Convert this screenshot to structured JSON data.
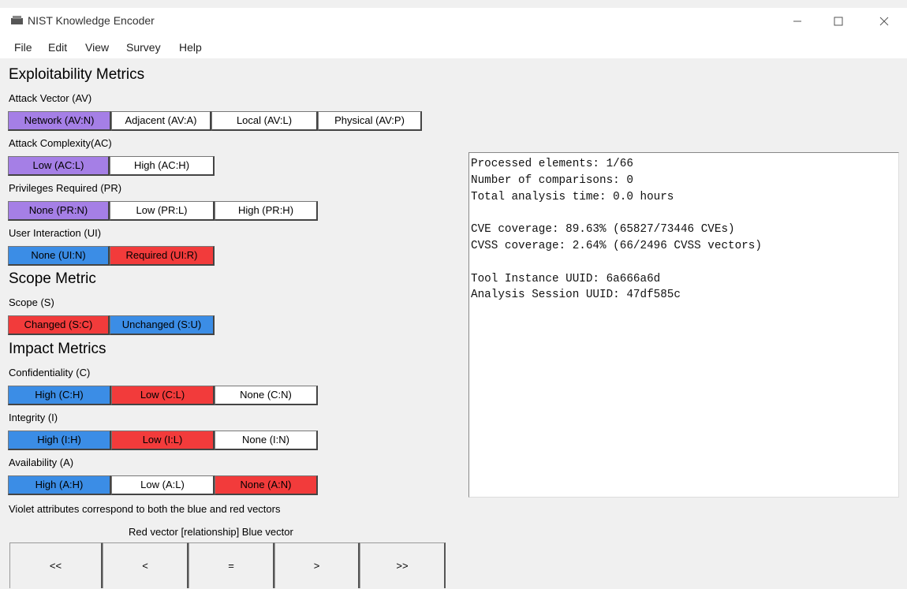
{
  "window": {
    "title": "NIST Knowledge Encoder",
    "controls": {
      "minimize": "—",
      "maximize": "☐",
      "close": "✕"
    }
  },
  "menu": [
    "File",
    "Edit",
    "View",
    "Survey",
    "Help"
  ],
  "sections": {
    "exploitability": "Exploitability Metrics",
    "scope": "Scope Metric",
    "impact": "Impact Metrics"
  },
  "metrics": {
    "av": {
      "label": "Attack Vector (AV)",
      "options": [
        "Network (AV:N)",
        "Adjacent (AV:A)",
        "Local (AV:L)",
        "Physical (AV:P)"
      ]
    },
    "ac": {
      "label": "Attack Complexity(AC)",
      "options": [
        "Low (AC:L)",
        "High (AC:H)"
      ]
    },
    "pr": {
      "label": "Privileges Required (PR)",
      "options": [
        "None (PR:N)",
        "Low (PR:L)",
        "High (PR:H)"
      ]
    },
    "ui": {
      "label": "User Interaction (UI)",
      "options": [
        "None (UI:N)",
        "Required (UI:R)"
      ]
    },
    "s": {
      "label": "Scope (S)",
      "options": [
        "Changed (S:C)",
        "Unchanged (S:U)"
      ]
    },
    "c": {
      "label": "Confidentiality (C)",
      "options": [
        "High (C:H)",
        "Low (C:L)",
        "None (C:N)"
      ]
    },
    "i": {
      "label": "Integrity (I)",
      "options": [
        "High (I:H)",
        "Low (I:L)",
        "None (I:N)"
      ]
    },
    "a": {
      "label": "Availability (A)",
      "options": [
        "High (A:H)",
        "Low (A:L)",
        "None (A:N)"
      ]
    }
  },
  "colors": {
    "violet": "#a57fe6",
    "blue": "#3b8de6",
    "red": "#f23b3b"
  },
  "legend_note": "Violet attributes correspond to both the blue and red vectors",
  "relationship_label": "Red vector [relationship] Blue vector",
  "nav_buttons": [
    "<<",
    "<",
    "=",
    ">",
    ">>"
  ],
  "output": {
    "processed": "Processed elements: 1/66",
    "comparisons": "Number of comparisons: 0",
    "time": "Total analysis time: 0.0 hours",
    "cve": "CVE coverage: 89.63% (65827/73446 CVEs)",
    "cvss": "CVSS coverage: 2.64% (66/2496 CVSS vectors)",
    "tool_uuid": "Tool Instance UUID: 6a666a6d",
    "session_uuid": "Analysis Session UUID: 47df585c"
  }
}
